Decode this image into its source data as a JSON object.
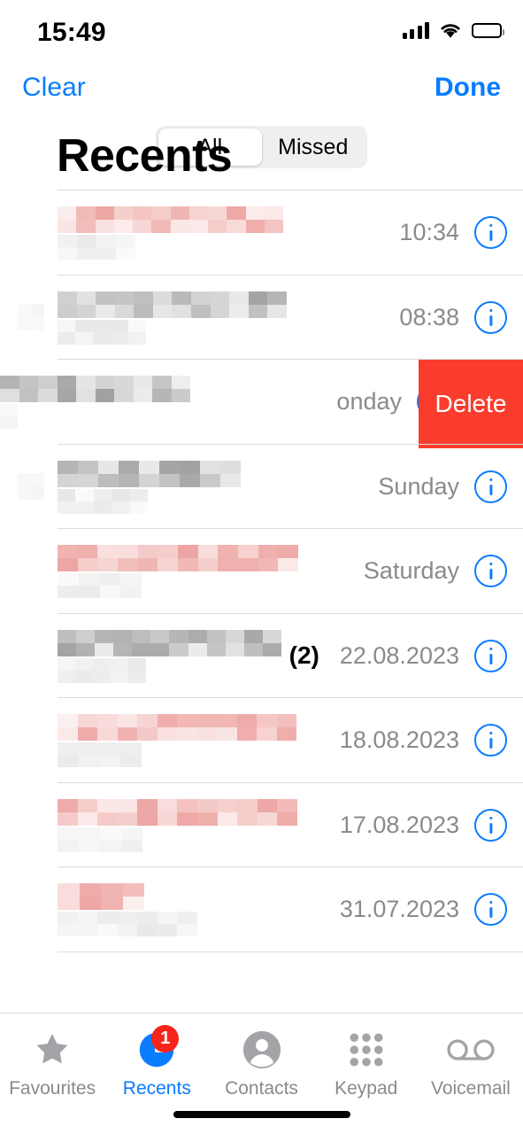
{
  "status_bar": {
    "time": "15:49",
    "cellular_icon": "cellular-signal-icon",
    "wifi_icon": "wifi-icon",
    "battery_icon": "battery-full-icon"
  },
  "nav_bar": {
    "clear_label": "Clear",
    "done_label": "Done",
    "segments": [
      {
        "label": "All",
        "selected": true
      },
      {
        "label": "Missed",
        "selected": false
      }
    ]
  },
  "page_title": "Recents",
  "colors": {
    "accent_blue": "#0a7cff",
    "delete_red": "#fa3c2d",
    "badge_red": "#f6241a",
    "secondary_text": "#8a8a8e",
    "separator": "#dcdcdc",
    "missed_call_tint": "#f0a3a0",
    "normal_call_tint": "#9a9a9a"
  },
  "call_list": [
    {
      "name_redacted": true,
      "call_type": "missed",
      "has_lead_icon": false,
      "count": "",
      "when": "10:34",
      "info_label": "i",
      "name_width": 255,
      "sub_width": 88,
      "swiped": false
    },
    {
      "name_redacted": true,
      "call_type": "normal",
      "has_lead_icon": true,
      "count": "",
      "when": "08:38",
      "info_label": "i",
      "name_width": 259,
      "sub_width": 100,
      "swiped": false
    },
    {
      "name_redacted": true,
      "call_type": "normal",
      "has_lead_icon": true,
      "count": "",
      "when": "onday",
      "info_label": "i",
      "name_width": 215,
      "sub_width": 20,
      "swiped": true,
      "delete_label": "Delete"
    },
    {
      "name_redacted": true,
      "call_type": "normal",
      "has_lead_icon": true,
      "count": "",
      "when": "Sunday",
      "info_label": "i",
      "name_width": 207,
      "sub_width": 102,
      "swiped": false
    },
    {
      "name_redacted": true,
      "call_type": "missed",
      "has_lead_icon": false,
      "count": "",
      "when": "Saturday",
      "info_label": "i",
      "name_width": 272,
      "sub_width": 95,
      "swiped": false
    },
    {
      "name_redacted": true,
      "call_type": "normal",
      "has_lead_icon": false,
      "count": "(2)",
      "when": "22.08.2023",
      "info_label": "i",
      "name_width": 253,
      "sub_width": 100,
      "swiped": false
    },
    {
      "name_redacted": true,
      "call_type": "missed",
      "has_lead_icon": false,
      "count": "",
      "when": "18.08.2023",
      "info_label": "i",
      "name_width": 270,
      "sub_width": 95,
      "swiped": false
    },
    {
      "name_redacted": true,
      "call_type": "missed",
      "has_lead_icon": false,
      "count": "",
      "when": "17.08.2023",
      "info_label": "i",
      "name_width": 271,
      "sub_width": 96,
      "swiped": false
    },
    {
      "name_redacted": true,
      "call_type": "missed",
      "has_lead_icon": false,
      "count": "",
      "when": "31.07.2023",
      "info_label": "i",
      "name_width": 98,
      "sub_width": 158,
      "swiped": false
    }
  ],
  "tab_bar": {
    "tabs": [
      {
        "label": "Favourites",
        "icon": "star-icon",
        "active": false,
        "badge": ""
      },
      {
        "label": "Recents",
        "icon": "clock-icon",
        "active": true,
        "badge": "1"
      },
      {
        "label": "Contacts",
        "icon": "person-circle-icon",
        "active": false,
        "badge": ""
      },
      {
        "label": "Keypad",
        "icon": "keypad-grid-icon",
        "active": false,
        "badge": ""
      },
      {
        "label": "Voicemail",
        "icon": "voicemail-icon",
        "active": false,
        "badge": ""
      }
    ]
  }
}
